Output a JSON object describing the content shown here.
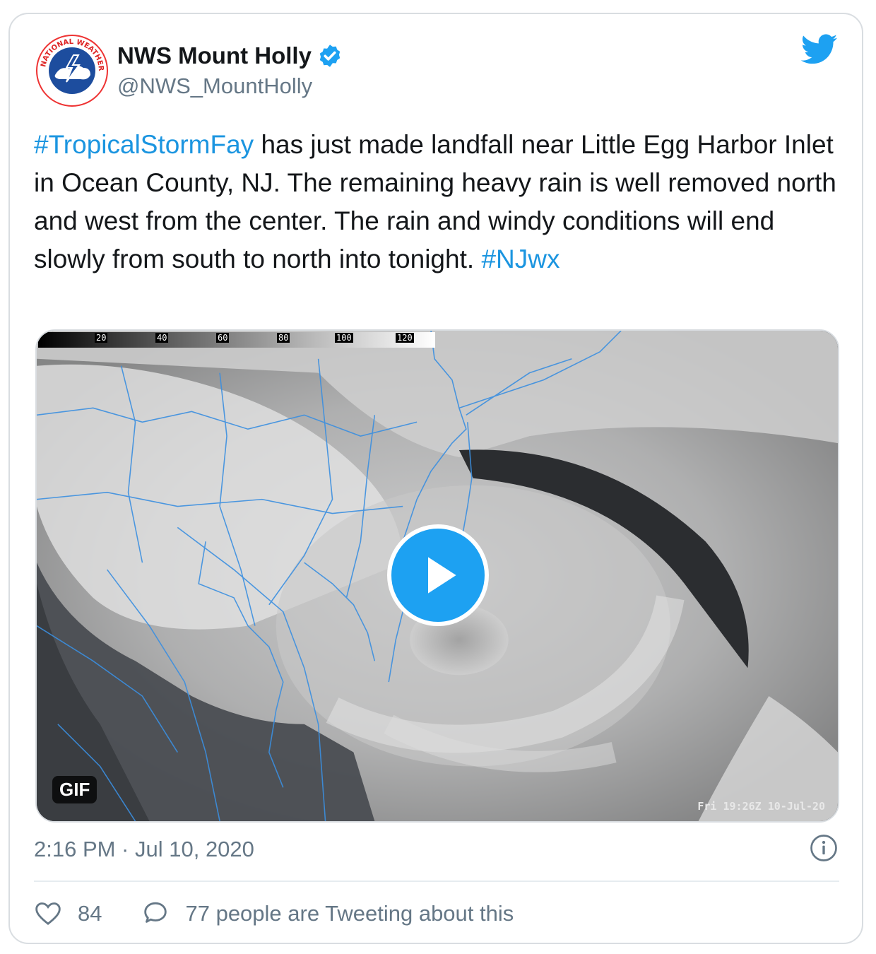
{
  "author": {
    "name": "NWS Mount Holly",
    "handle": "@NWS_MountHolly",
    "verified": true,
    "avatar_text": "NATIONAL WEATHER SERVICE"
  },
  "tweet": {
    "segments": [
      {
        "text": "#TropicalStormFay",
        "type": "hashtag"
      },
      {
        "text": " has just made landfall near Little Egg Harbor Inlet in Ocean County, NJ. The remaining heavy rain is well removed north and west from the center. The rain and windy conditions will end slowly from south to north into tonight. ",
        "type": "text"
      },
      {
        "text": "#NJwx",
        "type": "hashtag"
      }
    ]
  },
  "media": {
    "badge": "GIF",
    "timestamp_overlay": "Fri 19:26Z 10-Jul-20",
    "scale_ticks": [
      "20",
      "40",
      "60",
      "80",
      "100",
      "120"
    ]
  },
  "timestamp": "2:16 PM · Jul 10, 2020",
  "actions": {
    "like_count": "84",
    "tweeting_label": "77 people are Tweeting about this"
  },
  "colors": {
    "accent": "#1da1f2",
    "hashtag": "#1b95e0",
    "secondary_text": "#657786",
    "border": "#d9dde1"
  },
  "icons": {
    "brand": "twitter-bird-icon",
    "verified": "verified-badge-icon",
    "info": "info-icon",
    "like": "heart-icon",
    "reply": "speech-bubble-icon",
    "play": "play-icon"
  }
}
